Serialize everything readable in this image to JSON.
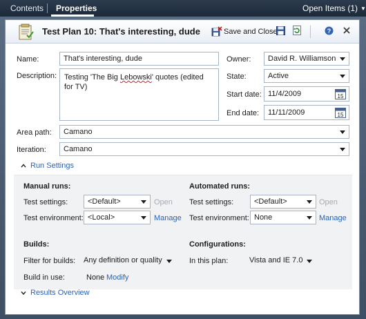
{
  "top_tabs": {
    "contents": "Contents",
    "properties": "Properties",
    "open_items": "Open Items (1)"
  },
  "titlebar": {
    "title": "Test Plan 10: That's interesting, dude",
    "save_close": "Save and Close"
  },
  "fields": {
    "name_label": "Name:",
    "name_value": "That's interesting, dude",
    "description_label": "Description:",
    "description_before": "Testing 'The Big ",
    "description_misspelled": "Lebowski",
    "description_after": "' quotes (edited for TV)",
    "owner_label": "Owner:",
    "owner_value": "David R. Williamson",
    "state_label": "State:",
    "state_value": "Active",
    "start_date_label": "Start date:",
    "start_date_value": "11/4/2009",
    "end_date_label": "End date:",
    "end_date_value": "11/11/2009",
    "calendar_day": "15",
    "area_path_label": "Area path:",
    "area_path_value": "Camano",
    "iteration_label": "Iteration:",
    "iteration_value": "Camano"
  },
  "run_settings": {
    "header": "Run Settings",
    "manual": {
      "title": "Manual runs:",
      "test_settings_label": "Test settings:",
      "test_settings_value": "<Default>",
      "open_label": "Open",
      "test_env_label": "Test environment:",
      "test_env_value": "<Local>",
      "manage_label": "Manage"
    },
    "automated": {
      "title": "Automated runs:",
      "test_settings_label": "Test settings:",
      "test_settings_value": "<Default>",
      "open_label": "Open",
      "test_env_label": "Test environment:",
      "test_env_value": "None",
      "manage_label": "Manage"
    },
    "builds": {
      "title": "Builds:",
      "filter_label": "Filter for builds:",
      "filter_value": "Any definition or quality",
      "in_use_label": "Build in use:",
      "in_use_value": "None",
      "modify_label": "Modify"
    },
    "configurations": {
      "title": "Configurations:",
      "in_plan_label": "In this plan:",
      "in_plan_value": "Vista and IE 7.0"
    }
  },
  "results_overview": {
    "header": "Results Overview"
  },
  "colors": {
    "link": "#2a62b8",
    "topbar": "#1c2939",
    "run_area": "#f1f2f4"
  }
}
